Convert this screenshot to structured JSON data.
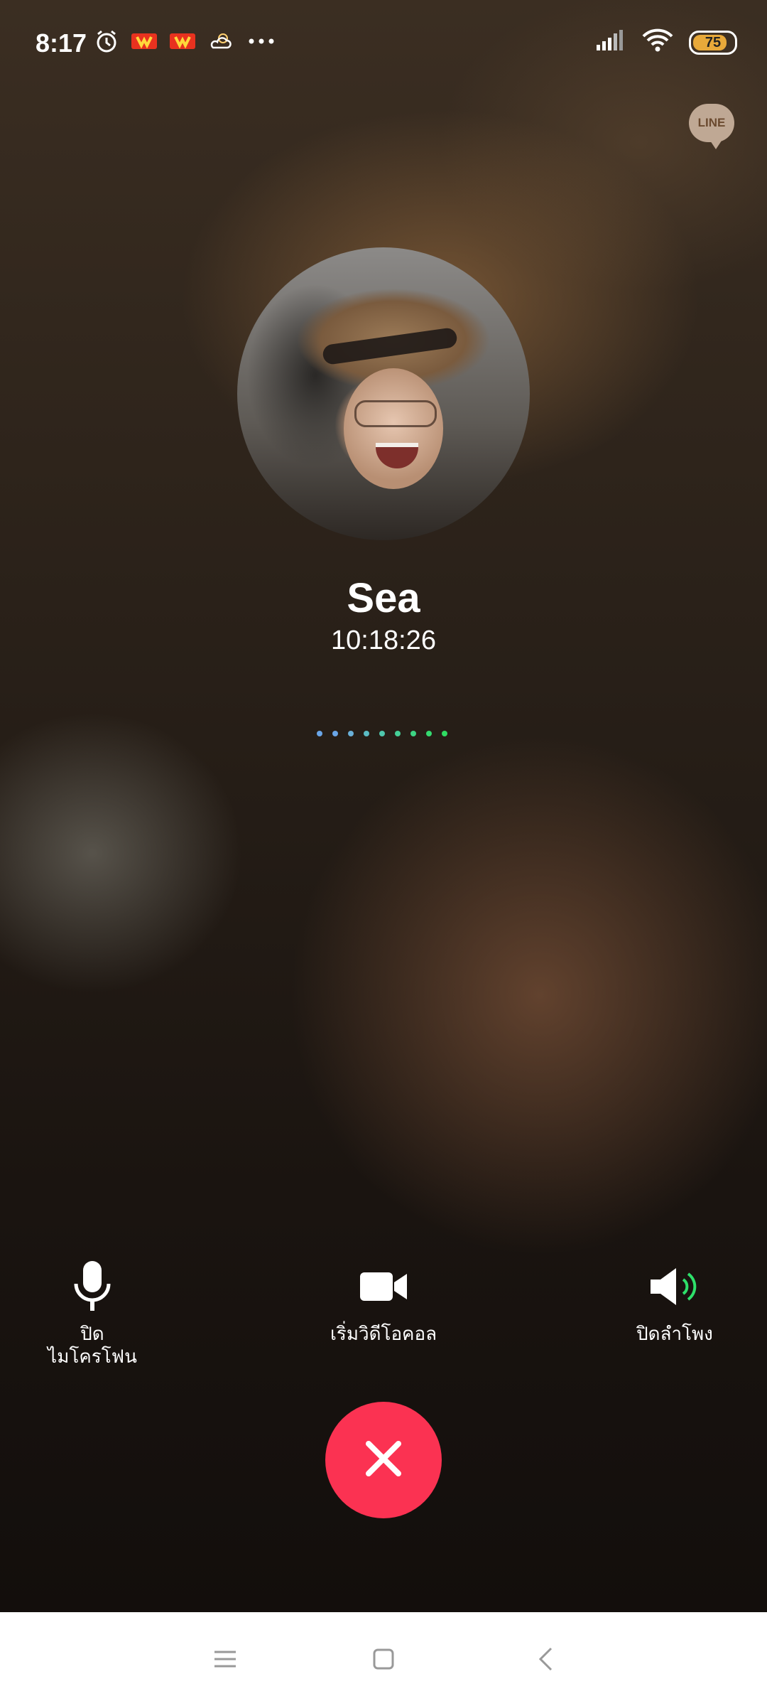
{
  "status_bar": {
    "time": "8:17",
    "battery": "75",
    "icons_left": [
      "alarm-icon",
      "app-notification-icon",
      "app-notification-icon",
      "weather-icon",
      "more-icon"
    ],
    "icons_right": [
      "signal-icon",
      "wifi-icon",
      "battery-icon"
    ]
  },
  "app_badge": {
    "label": "LINE"
  },
  "call": {
    "name": "Sea",
    "duration": "10:18:26",
    "dot_colors": [
      "#6aa6e8",
      "#6aa6e8",
      "#6ab0d8",
      "#5bbcc4",
      "#4fc7ad",
      "#45cf97",
      "#3dd584",
      "#35da70",
      "#2fdc62"
    ]
  },
  "controls": {
    "mic": {
      "label_line1": "ปิด",
      "label_line2": "ไมโครโฟน",
      "icon": "microphone-icon"
    },
    "video": {
      "label": "เริ่มวิดีโอคอล",
      "icon": "video-camera-icon"
    },
    "speaker": {
      "label": "ปิดลำโพง",
      "icon": "speaker-icon",
      "accent": "#2ee06a"
    }
  },
  "end_call": {
    "icon": "close-icon",
    "color": "#fb3252"
  },
  "nav": {
    "items": [
      "menu-icon",
      "home-icon",
      "back-icon"
    ]
  }
}
